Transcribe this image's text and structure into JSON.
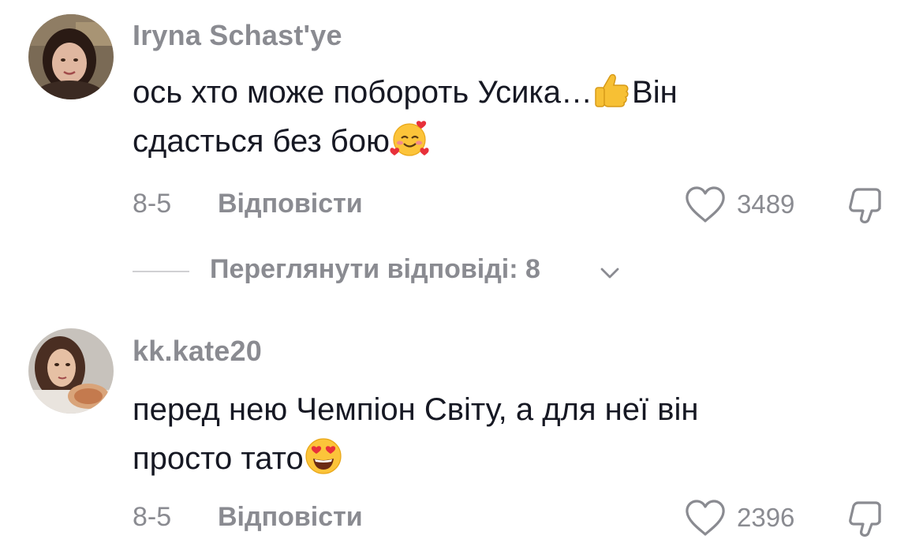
{
  "comments": [
    {
      "username": "Iryna Schast'ye",
      "text_line1": "ось хто може побороть Усика…",
      "text_line1_end": "Він",
      "text_line2": "сдасться без бою",
      "emojis": [
        "thumbs-up-emoji",
        "smiling-face-with-hearts-emoji"
      ],
      "date": "8-5",
      "reply_label": "Відповісти",
      "likes": "3489",
      "view_replies": "Переглянути відповіді: 8"
    },
    {
      "username": "kk.kate20",
      "text_line1": "перед нею Чемпіон Світу, а для неї він",
      "text_line2": "просто тато",
      "emojis": [
        "heart-eyes-emoji"
      ],
      "date": "8-5",
      "reply_label": "Відповісти",
      "likes": "2396"
    }
  ],
  "colors": {
    "text_primary": "#161823",
    "text_secondary": "#8a8b91",
    "divider": "#d0d0d3",
    "background": "#ffffff"
  },
  "icons": [
    "heart-outline-icon",
    "thumbs-down-icon",
    "chevron-down-icon"
  ]
}
